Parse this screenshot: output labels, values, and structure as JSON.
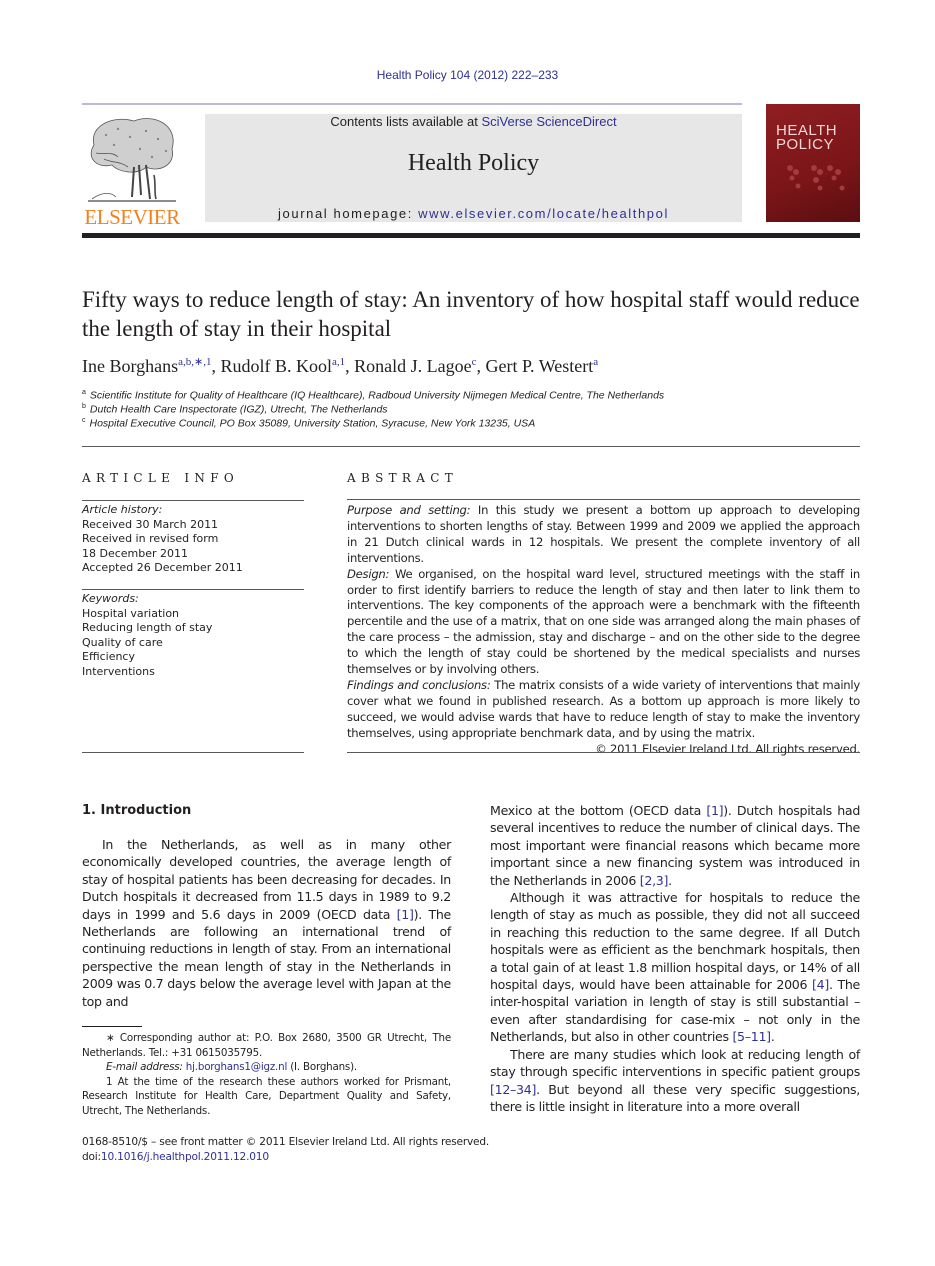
{
  "header": {
    "journal_ref": "Health Policy 104 (2012) 222–233",
    "contents_prefix": "Contents lists available at ",
    "contents_link": "SciVerse ScienceDirect",
    "journal_title": "Health Policy",
    "homepage_prefix": "journal homepage: ",
    "homepage_link": "www.elsevier.com/locate/healthpol",
    "publisher_logo_text": "ELSEVIER",
    "cover_title_line1": "HEALTH",
    "cover_title_line2": "POLICY",
    "brand_color": "#f0821e",
    "link_color": "#2e3192",
    "cover_color": "#8f1e22"
  },
  "article": {
    "title": "Fifty ways to reduce length of stay: An inventory of how hospital staff would reduce the length of stay in their hospital",
    "authors": [
      {
        "name": "Ine Borghans",
        "sup": "a,b,∗,1",
        "sep": ", "
      },
      {
        "name": "Rudolf B. Kool",
        "sup": "a,1",
        "sep": ", "
      },
      {
        "name": "Ronald J. Lagoe",
        "sup": "c",
        "sep": ", "
      },
      {
        "name": "Gert P. Westert",
        "sup": "a",
        "sep": ""
      }
    ],
    "affiliations": [
      {
        "key": "a",
        "text": "Scientific Institute for Quality of Healthcare (IQ Healthcare), Radboud University Nijmegen Medical Centre, The Netherlands"
      },
      {
        "key": "b",
        "text": "Dutch Health Care Inspectorate (IGZ), Utrecht, The Netherlands"
      },
      {
        "key": "c",
        "text": "Hospital Executive Council, PO Box 35089, University Station, Syracuse, New York 13235, USA"
      }
    ]
  },
  "article_info": {
    "heading": "ARTICLE INFO",
    "history_label": "Article history:",
    "history": [
      "Received 30 March 2011",
      "Received in revised form",
      "18 December 2011",
      "Accepted 26 December 2011"
    ],
    "keywords_label": "Keywords:",
    "keywords": [
      "Hospital variation",
      "Reducing length of stay",
      "Quality of care",
      "Efficiency",
      "Interventions"
    ]
  },
  "abstract": {
    "heading": "ABSTRACT",
    "sections": [
      {
        "label": "Purpose and setting:",
        "text": " In this study we present a bottom up approach to developing interventions to shorten lengths of stay. Between 1999 and 2009 we applied the approach in 21 Dutch clinical wards in 12 hospitals. We present the complete inventory of all interventions."
      },
      {
        "label": "Design:",
        "text": " We organised, on the hospital ward level, structured meetings with the staff in order to first identify barriers to reduce the length of stay and then later to link them to interventions. The key components of the approach were a benchmark with the fifteenth percentile and the use of a matrix, that on one side was arranged along the main phases of the care process – the admission, stay and discharge – and on the other side to the degree to which the length of stay could be shortened by the medical specialists and nurses themselves or by involving others."
      },
      {
        "label": "Findings and conclusions:",
        "text": " The matrix consists of a wide variety of interventions that mainly cover what we found in published research. As a bottom up approach is more likely to succeed, we would advise wards that have to reduce length of stay to make the inventory themselves, using appropriate benchmark data, and by using the matrix."
      }
    ],
    "copyright": "© 2011 Elsevier Ireland Ltd. All rights reserved."
  },
  "introduction": {
    "heading": "1.  Introduction",
    "p1_a": "In the Netherlands, as well as in many other economically developed countries, the average length of stay of hospital patients has been decreasing for decades. In Dutch hospitals it decreased from 11.5 days in 1989 to 9.2 days in 1999 and 5.6 days in 2009 (OECD data ",
    "p1_ref1": "[1]",
    "p1_b": "). The Netherlands are following an international trend of continuing reductions in length of stay. From an international perspective the mean length of stay in the Netherlands in 2009 was 0.7 days below the average level with Japan at the top and",
    "p1_c": "Mexico at the bottom (OECD data ",
    "p1_ref2": "[1]",
    "p1_d": "). Dutch hospitals had several incentives to reduce the number of clinical days. The most important were financial reasons which became more important since a new financing system was introduced in the Netherlands in 2006 ",
    "p1_ref3": "[2,3]",
    "p1_e": ".",
    "p2_a": "Although it was attractive for hospitals to reduce the length of stay as much as possible, they did not all succeed in reaching this reduction to the same degree. If all Dutch hospitals were as efficient as the benchmark hospitals, then a total gain of at least 1.8 million hospital days, or 14% of all hospital days, would have been attainable for 2006 ",
    "p2_ref1": "[4]",
    "p2_b": ". The inter-hospital variation in length of stay is still substantial – even after standardising for case-mix – not only in the Netherlands, but also in other countries ",
    "p2_ref2": "[5–11]",
    "p2_c": ".",
    "p3_a": "There are many studies which look at reducing length of stay through specific interventions in specific patient groups ",
    "p3_ref1": "[12–34]",
    "p3_b": ". But beyond all these very specific suggestions, there is little insight in literature into a more overall"
  },
  "footnotes": {
    "corresponding": "∗  Corresponding author at: P.O. Box 2680, 3500 GR Utrecht, The Netherlands. Tel.: +31 0615035795.",
    "email_label": "E-mail address:",
    "email": "hj.borghans1@igz.nl",
    "email_suffix": " (I. Borghans).",
    "note1": "1  At the time of the research these authors worked for Prismant, Research Institute for Health Care, Department Quality and Safety, Utrecht, The Netherlands."
  },
  "bottom_meta": {
    "issn_line": "0168-8510/$ – see front matter © 2011 Elsevier Ireland Ltd. All rights reserved.",
    "doi_prefix": "doi:",
    "doi": "10.1016/j.healthpol.2011.12.010"
  }
}
